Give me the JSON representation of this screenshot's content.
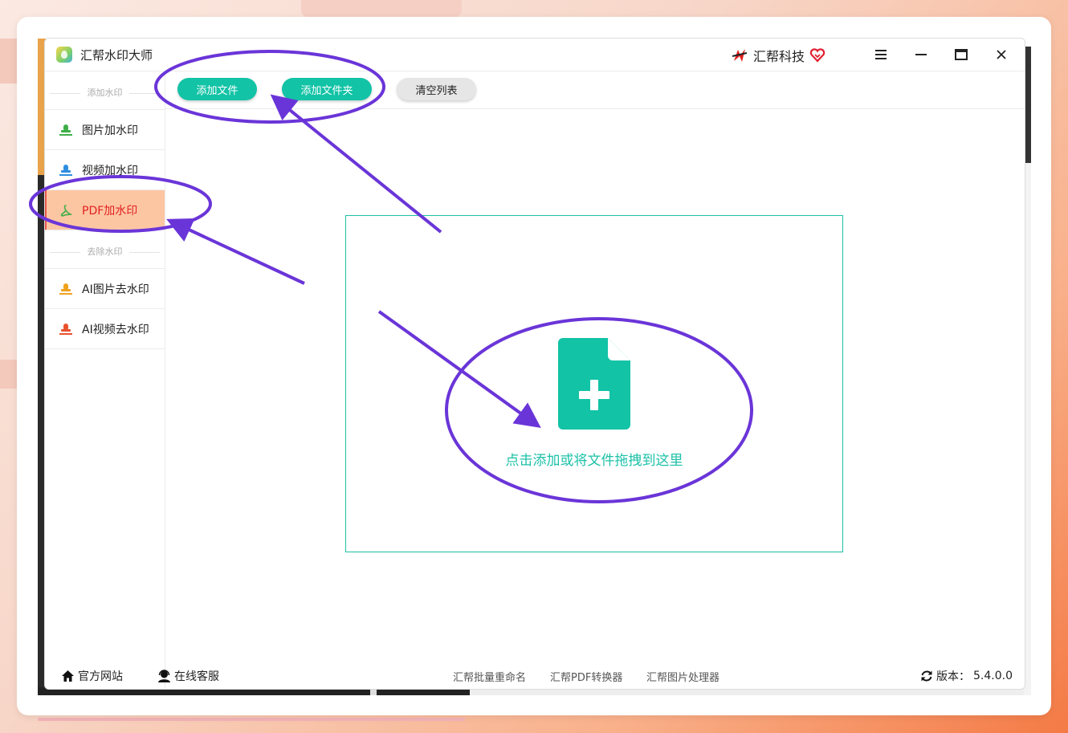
{
  "app": {
    "title": "汇帮水印大师",
    "brand": "汇帮科技"
  },
  "sidebar": {
    "section_add": "添加水印",
    "section_remove": "去除水印",
    "items": [
      {
        "label": "图片加水印"
      },
      {
        "label": "视频加水印"
      },
      {
        "label": "PDF加水印",
        "active": true
      },
      {
        "label": "AI图片去水印"
      },
      {
        "label": "AI视频去水印"
      }
    ]
  },
  "toolbar": {
    "add_file": "添加文件",
    "add_folder": "添加文件夹",
    "clear_list": "清空列表"
  },
  "dropzone": {
    "text": "点击添加或将文件拖拽到这里"
  },
  "footer": {
    "website": "官方网站",
    "support": "在线客服",
    "links": [
      "汇帮批量重命名",
      "汇帮PDF转换器",
      "汇帮图片处理器"
    ],
    "version_label": "版本：",
    "version": "5.4.0.0"
  },
  "colors": {
    "accent": "#12c3a6",
    "active_bg": "#fdc6a3",
    "active_text": "#e02020",
    "annotation": "#6a35d8"
  }
}
